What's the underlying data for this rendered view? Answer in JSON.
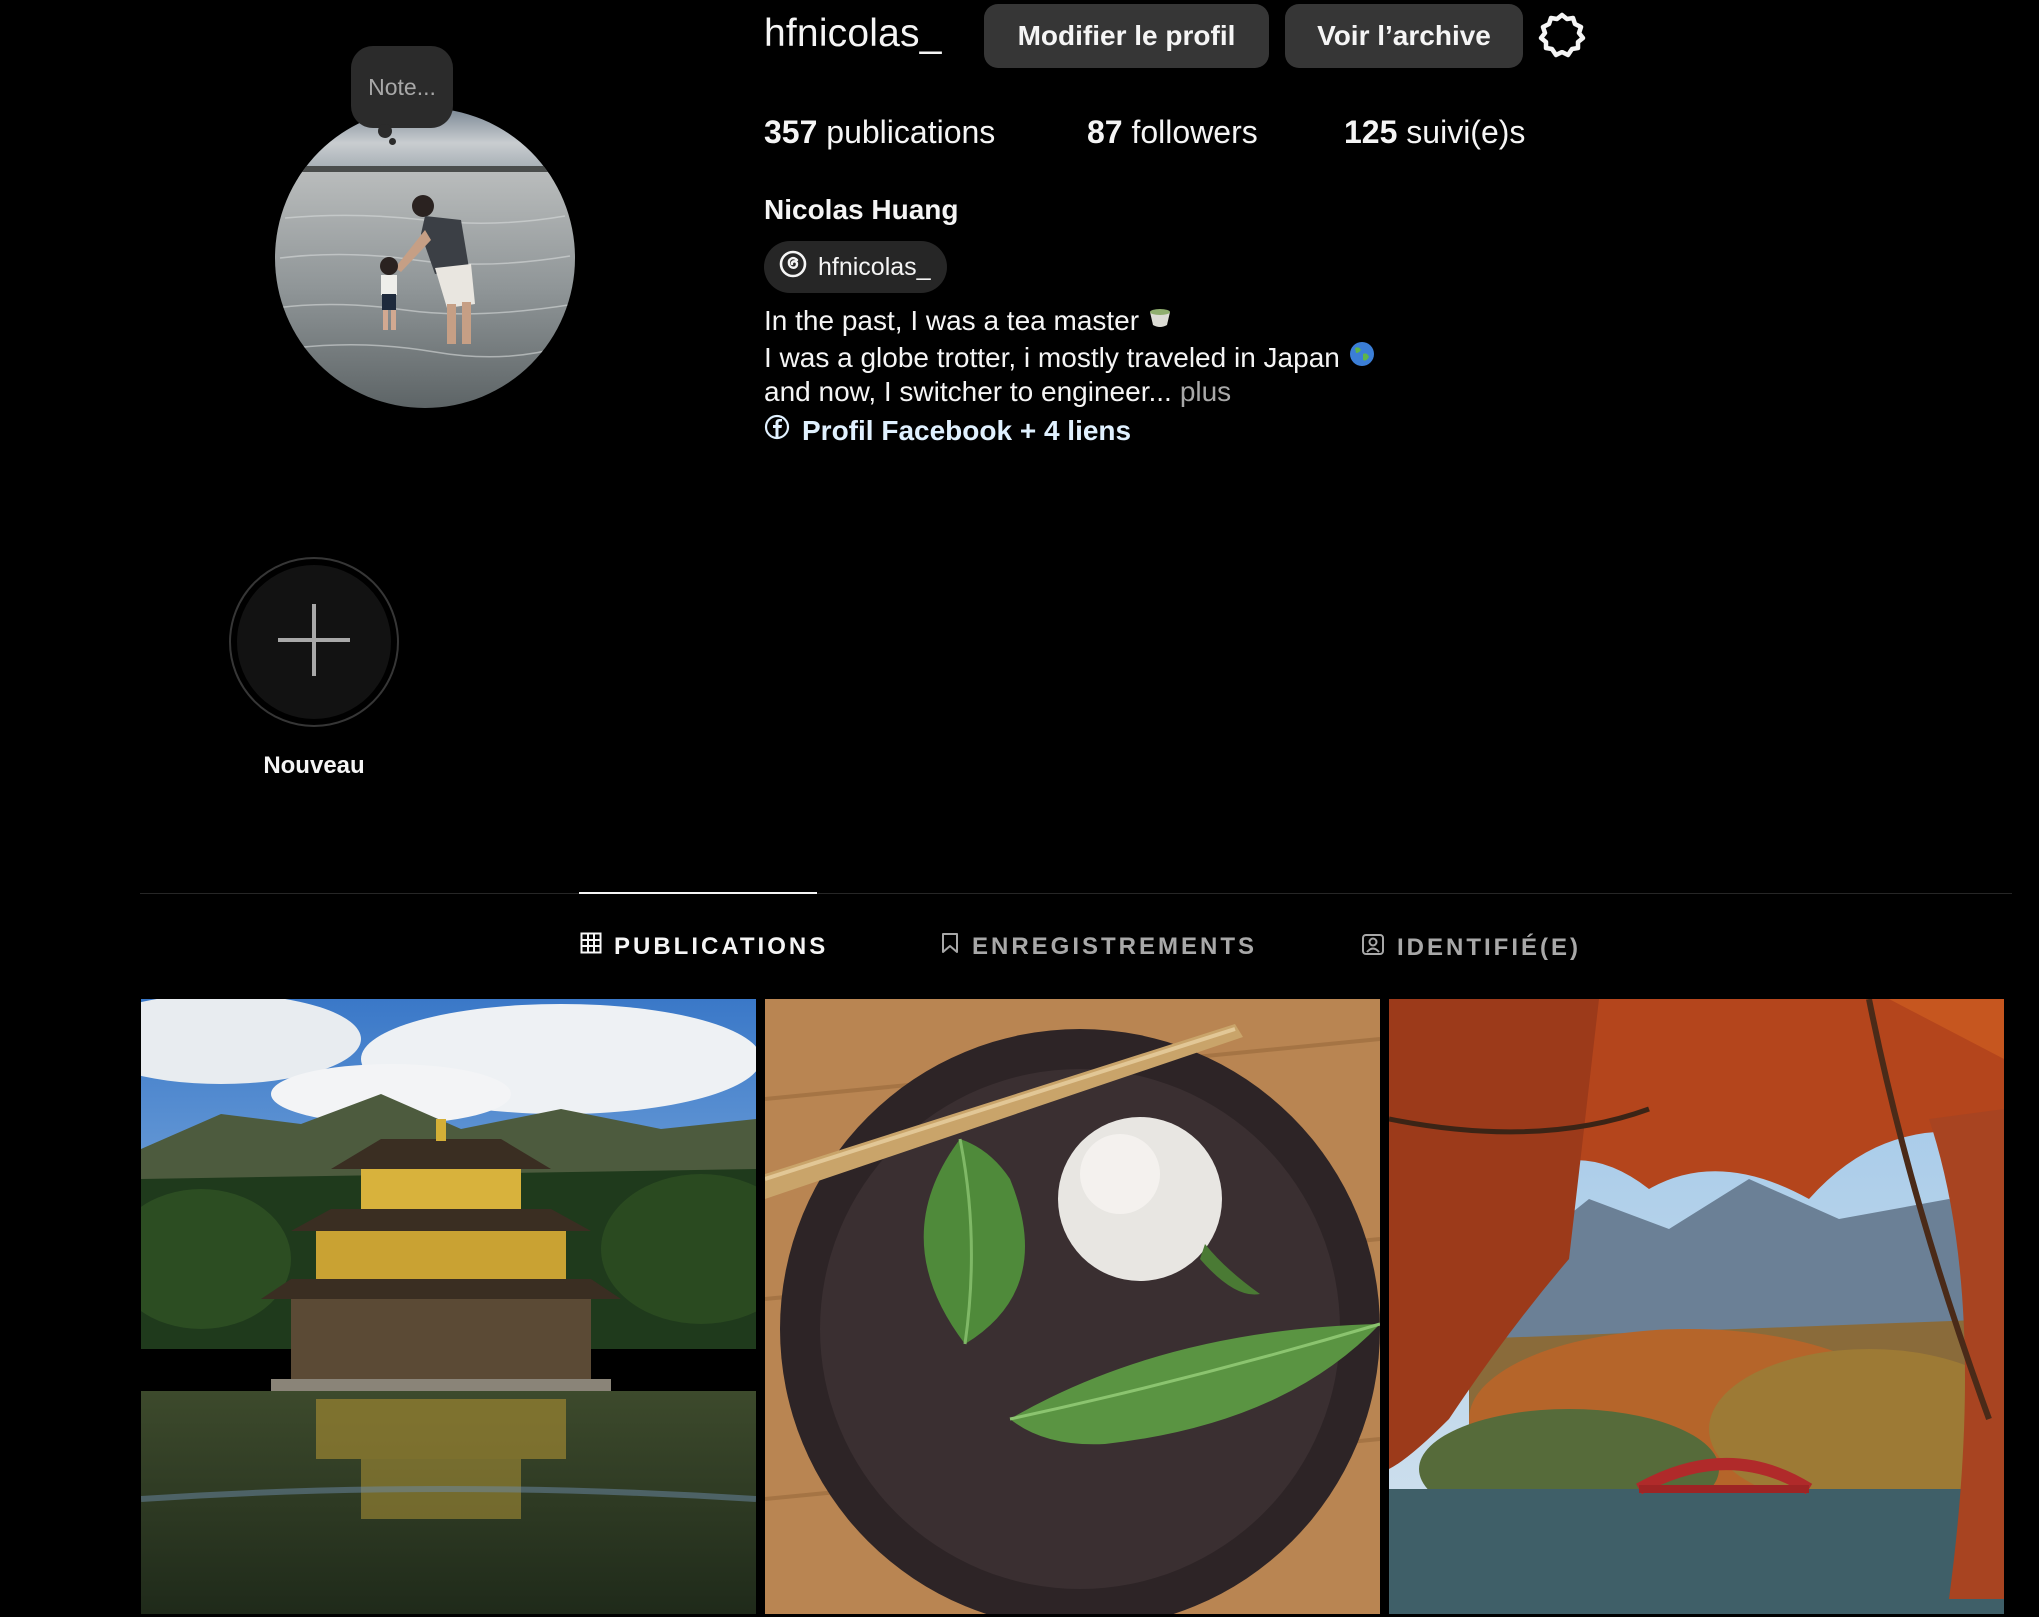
{
  "profile": {
    "username": "hfnicolas_",
    "note_placeholder": "Note...",
    "edit_button": "Modifier le profil",
    "archive_button": "Voir l’archive",
    "stats": {
      "posts_count": "357",
      "posts_label": " publications",
      "followers_count": "87",
      "followers_label": " followers",
      "following_count": "125",
      "following_label": " suivi(e)s"
    },
    "full_name": "Nicolas Huang",
    "threads_handle": "hfnicolas_",
    "bio": {
      "line1": "In the past, I was a tea master",
      "line2": "I was a globe trotter, i mostly traveled in Japan",
      "line3": "and now, I switcher to engineer...",
      "more": "plus"
    },
    "links_label": "Profil Facebook + 4 liens"
  },
  "highlights": {
    "new_label": "Nouveau"
  },
  "tabs": {
    "posts": "PUBLICATIONS",
    "saved": "ENREGISTREMENTS",
    "tagged": "IDENTIFIÉ(E)"
  },
  "colors": {
    "background": "#000000",
    "button_bg": "#363636",
    "secondary_text": "#a8a8a8",
    "link_text": "#e0f1ff"
  }
}
